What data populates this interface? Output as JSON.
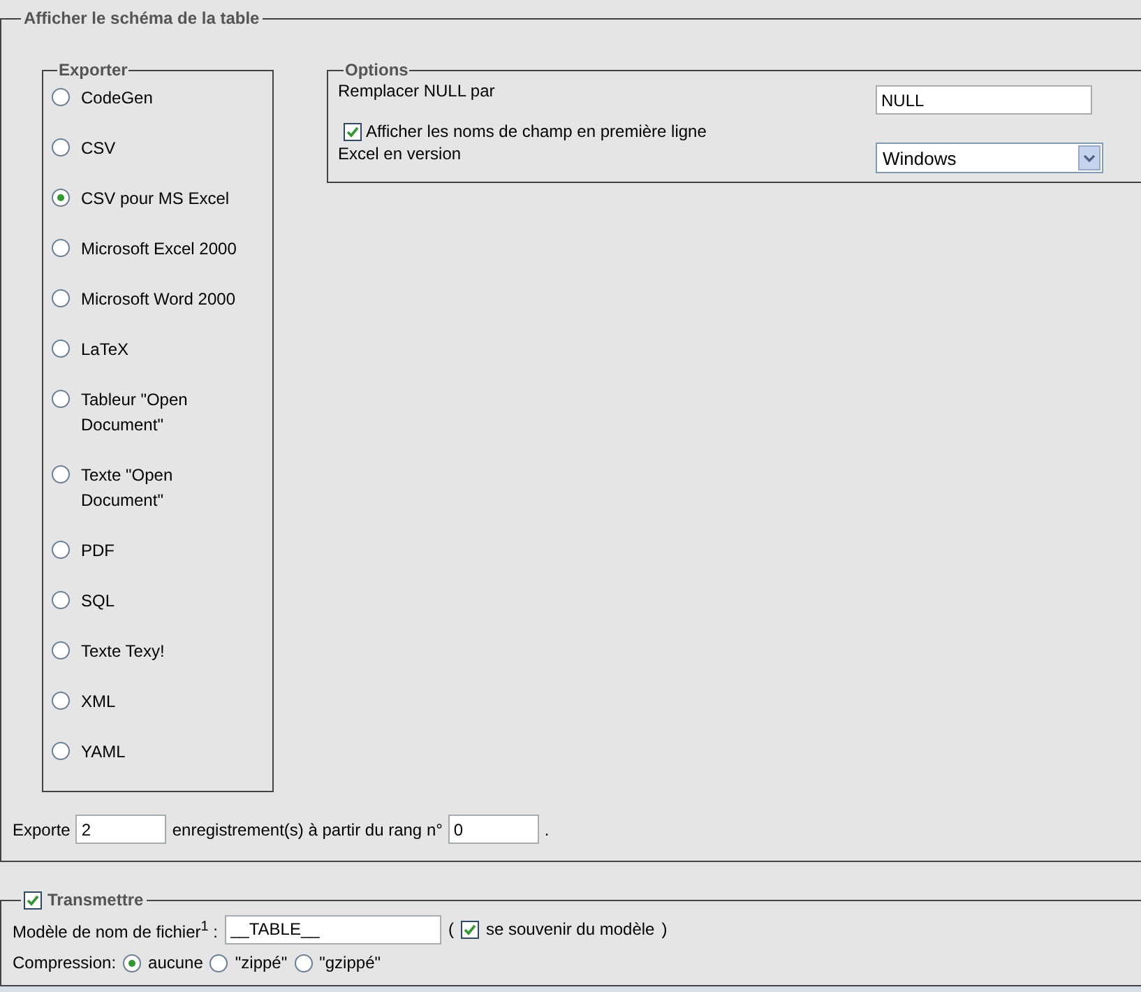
{
  "main_panel": {
    "legend": "Afficher le schéma de la table",
    "export_formats": {
      "legend": "Exporter",
      "items": [
        {
          "label": "CodeGen",
          "selected": false
        },
        {
          "label": "CSV",
          "selected": false
        },
        {
          "label": "CSV pour MS Excel",
          "selected": true
        },
        {
          "label": "Microsoft Excel 2000",
          "selected": false
        },
        {
          "label": "Microsoft Word 2000",
          "selected": false
        },
        {
          "label": "LaTeX",
          "selected": false
        },
        {
          "label": "Tableur \"Open Document\"",
          "selected": false
        },
        {
          "label": "Texte \"Open Document\"",
          "selected": false
        },
        {
          "label": "PDF",
          "selected": false
        },
        {
          "label": "SQL",
          "selected": false
        },
        {
          "label": "Texte Texy!",
          "selected": false
        },
        {
          "label": "XML",
          "selected": false
        },
        {
          "label": "YAML",
          "selected": false
        }
      ]
    },
    "options": {
      "legend": "Options",
      "null_label": "Remplacer NULL par",
      "null_value": "NULL",
      "header_checkbox": {
        "label": "Afficher les noms de champ en première ligne",
        "checked": true
      },
      "excel_label": "Excel en version",
      "excel_value": "Windows"
    },
    "records": {
      "prefix": "Exporte",
      "count": "2",
      "middle": "enregistrement(s) à partir du rang n°",
      "start": "0",
      "suffix": "."
    }
  },
  "transmit_panel": {
    "legend": "Transmettre",
    "checked": true,
    "filename_label": "Modèle de nom de fichier$^{1}$ :",
    "filename_value": "__TABLE__",
    "open_paren": "(",
    "remember": {
      "label": "se souvenir du modèle",
      "checked": true
    },
    "close_paren": ")",
    "compression_label": "Compression:",
    "compression": [
      {
        "label": "aucune",
        "selected": true
      },
      {
        "label": "\"zippé\"",
        "selected": false
      },
      {
        "label": "\"gzippé\"",
        "selected": false
      }
    ]
  }
}
